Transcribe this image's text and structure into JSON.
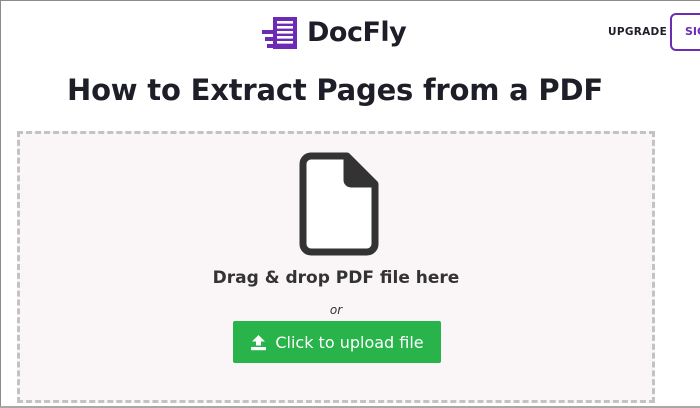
{
  "header": {
    "brand": "DocFly",
    "upgrade_label": "UPGRADE",
    "signin_label": "SIGN IN"
  },
  "main": {
    "title": "How to Extract Pages from a PDF",
    "dropzone": {
      "drop_text": "Drag & drop PDF file here",
      "or_text": "or",
      "upload_label": "Click to upload file"
    }
  },
  "icons": {
    "logo": "docfly-logo-icon",
    "file": "file-icon",
    "upload": "upload-icon"
  },
  "colors": {
    "brand_purple": "#6b2bb5",
    "upload_green": "#28b34b",
    "text_dark": "#1e1e28",
    "dropzone_bg": "#faf6f7",
    "dropzone_border": "#c3c3c3"
  }
}
